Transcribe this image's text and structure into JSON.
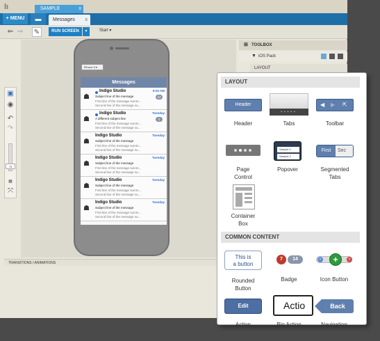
{
  "topbar": {
    "menu_label": "+ MENU",
    "tabs": [
      {
        "label": "SAMPLE",
        "close": "x"
      },
      {
        "label": "Messages",
        "close": "x"
      }
    ]
  },
  "toolbar": {
    "run_label": "RUN SCREEN",
    "start_label": "Start ▾"
  },
  "left_tools": {
    "zoom_value": "75"
  },
  "device": {
    "selector_label": "iPhone 5 ▾",
    "nav_title": "Messages",
    "messages": [
      {
        "from": "Indigo Studio",
        "unread": true,
        "time": "9:03 AM",
        "subject": "Subject line of the message",
        "line1": "First line of the message summ...",
        "line2": "Second line of the message su...",
        "badge": "12"
      },
      {
        "from": "Indigo Studio",
        "unread": true,
        "time": "Tuesday",
        "subject": "A different subject line",
        "line1": "First line of the message summ...",
        "line2": "Second line of the message su...",
        "badge": "2"
      },
      {
        "from": "Indigo Studio",
        "unread": false,
        "time": "Tuesday",
        "subject": "Subject line of the message",
        "line1": "First line of the message summ...",
        "line2": "Second line of the message su...",
        "badge": ""
      },
      {
        "from": "Indigo Studio",
        "unread": false,
        "time": "Tuesday",
        "subject": "Subject line of the message",
        "line1": "First line of the message summ...",
        "line2": "Second line of the message su...",
        "badge": ""
      },
      {
        "from": "Indigo Studio",
        "unread": false,
        "time": "Tuesday",
        "subject": "Subject line of the message",
        "line1": "First line of the message summ...",
        "line2": "Second line of the message su...",
        "badge": ""
      },
      {
        "from": "Indigo Studio",
        "unread": false,
        "time": "Tuesday",
        "subject": "Subject line of the message",
        "line1": "First line of the message summ...",
        "line2": "Second line of the message su...",
        "badge": ""
      }
    ]
  },
  "bottom_bar": {
    "label": "TRANSITIONS / ANIMATIONS"
  },
  "toolbox": {
    "header": "TOOLBOX",
    "pack": "iOS Pack",
    "layout_row": "LAYOUT"
  },
  "callout": {
    "layout_header": "LAYOUT",
    "common_header": "COMMON CONTENT",
    "items": {
      "header": {
        "label": "Header",
        "sample": "Header"
      },
      "tabs": {
        "label": "Tabs"
      },
      "toolbar": {
        "label": "Toolbar"
      },
      "page_control": {
        "label": "Page\nControl"
      },
      "popover": {
        "label": "Popover",
        "rows": [
          "Sample 1",
          "Sample 2"
        ]
      },
      "segmented_tabs": {
        "label": "Segmented\nTabs",
        "sample_first": "First",
        "sample_second": "Sec"
      },
      "container_box": {
        "label": "Container\nBox"
      },
      "rounded_button": {
        "label": "Rounded\nButton",
        "sample": "This is\na button"
      },
      "badge": {
        "label": "Badge",
        "sample_red": "7",
        "sample_gray": "14"
      },
      "icon_button": {
        "label": "Icon Button"
      },
      "action": {
        "label": "Action",
        "sample": "Edit"
      },
      "big_action": {
        "label": "Big Action",
        "sample": "Actio"
      },
      "navigation": {
        "label": "Navigation",
        "sample": "Back"
      }
    }
  },
  "colors": {
    "accent_blue": "#1e80c4",
    "ios_blue": "#5f7fae",
    "unread_dot": "#2a6fd1"
  }
}
